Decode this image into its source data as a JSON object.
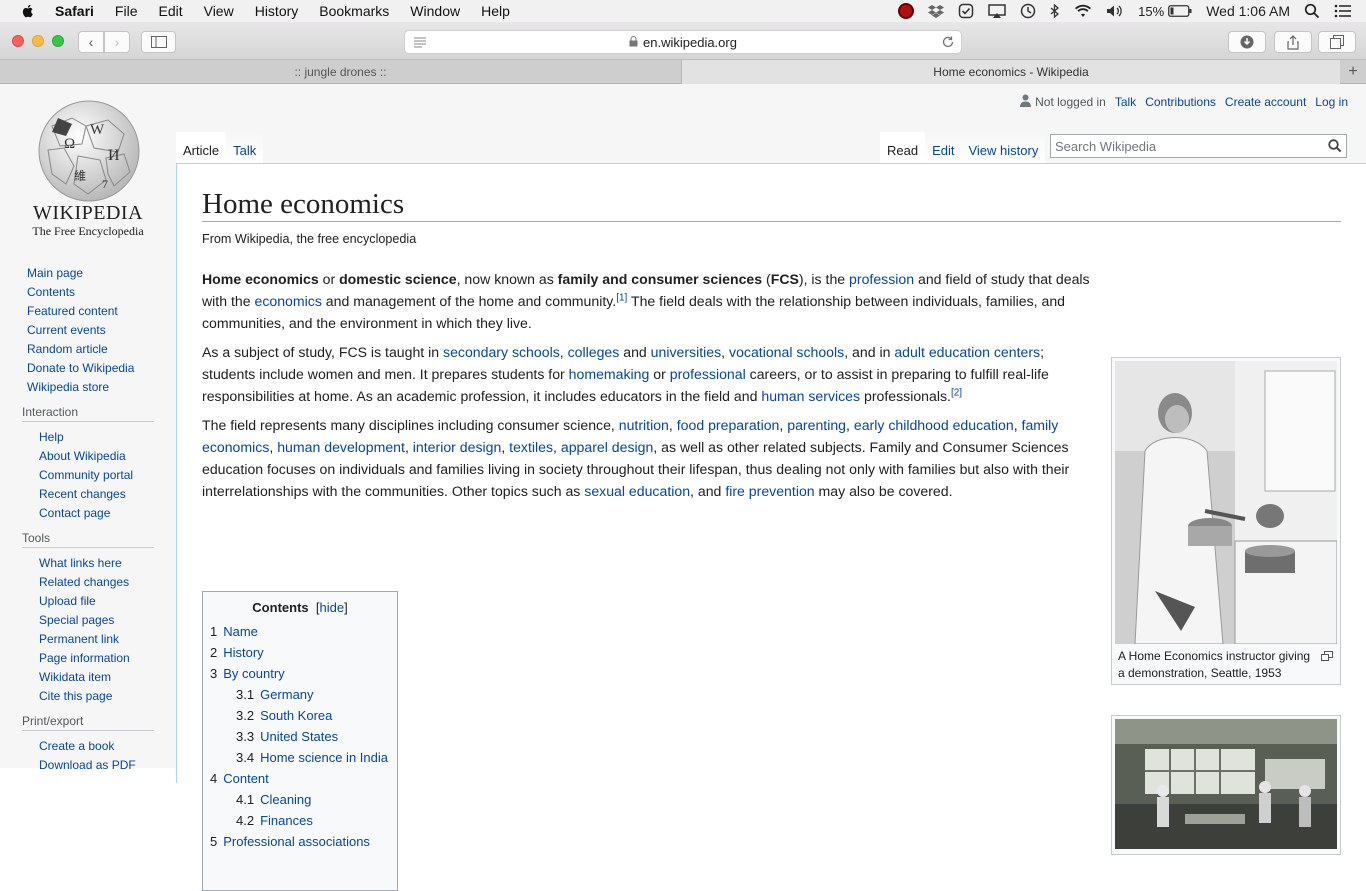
{
  "menubar": {
    "app": "Safari",
    "items": [
      "File",
      "Edit",
      "View",
      "History",
      "Bookmarks",
      "Window",
      "Help"
    ],
    "battery": "15%",
    "clock": "Wed 1:06 AM"
  },
  "browser": {
    "url": "en.wikipedia.org",
    "tabs": [
      ":: jungle drones ::",
      "Home economics - Wikipedia"
    ]
  },
  "personal": {
    "not_logged": "Not logged in",
    "talk": "Talk",
    "contributions": "Contributions",
    "create": "Create account",
    "login": "Log in"
  },
  "logo": {
    "word": "Wikipedia",
    "tagline": "The Free Encyclopedia"
  },
  "nav": {
    "main": [
      "Main page",
      "Contents",
      "Featured content",
      "Current events",
      "Random article",
      "Donate to Wikipedia",
      "Wikipedia store"
    ],
    "interaction_title": "Interaction",
    "interaction": [
      "Help",
      "About Wikipedia",
      "Community portal",
      "Recent changes",
      "Contact page"
    ],
    "tools_title": "Tools",
    "tools": [
      "What links here",
      "Related changes",
      "Upload file",
      "Special pages",
      "Permanent link",
      "Page information",
      "Wikidata item",
      "Cite this page"
    ],
    "print_title": "Print/export",
    "print": [
      "Create a book",
      "Download as PDF"
    ]
  },
  "tabs": {
    "article": "Article",
    "talk": "Talk",
    "read": "Read",
    "edit": "Edit",
    "history": "View history",
    "search_placeholder": "Search Wikipedia"
  },
  "article": {
    "title": "Home economics",
    "subtitle": "From Wikipedia, the free encyclopedia"
  },
  "toc": {
    "title": "Contents",
    "hide": "hide",
    "items": [
      {
        "num": "1",
        "label": "Name"
      },
      {
        "num": "2",
        "label": "History"
      },
      {
        "num": "3",
        "label": "By country"
      },
      {
        "num": "3.1",
        "label": "Germany"
      },
      {
        "num": "3.2",
        "label": "South Korea"
      },
      {
        "num": "3.3",
        "label": "United States"
      },
      {
        "num": "3.4",
        "label": "Home science in India"
      },
      {
        "num": "4",
        "label": "Content"
      },
      {
        "num": "4.1",
        "label": "Cleaning"
      },
      {
        "num": "4.2",
        "label": "Finances"
      },
      {
        "num": "5",
        "label": "Professional associations"
      }
    ]
  },
  "images": {
    "caption1": "A Home Economics instructor giving a demonstration, Seattle, 1953"
  }
}
